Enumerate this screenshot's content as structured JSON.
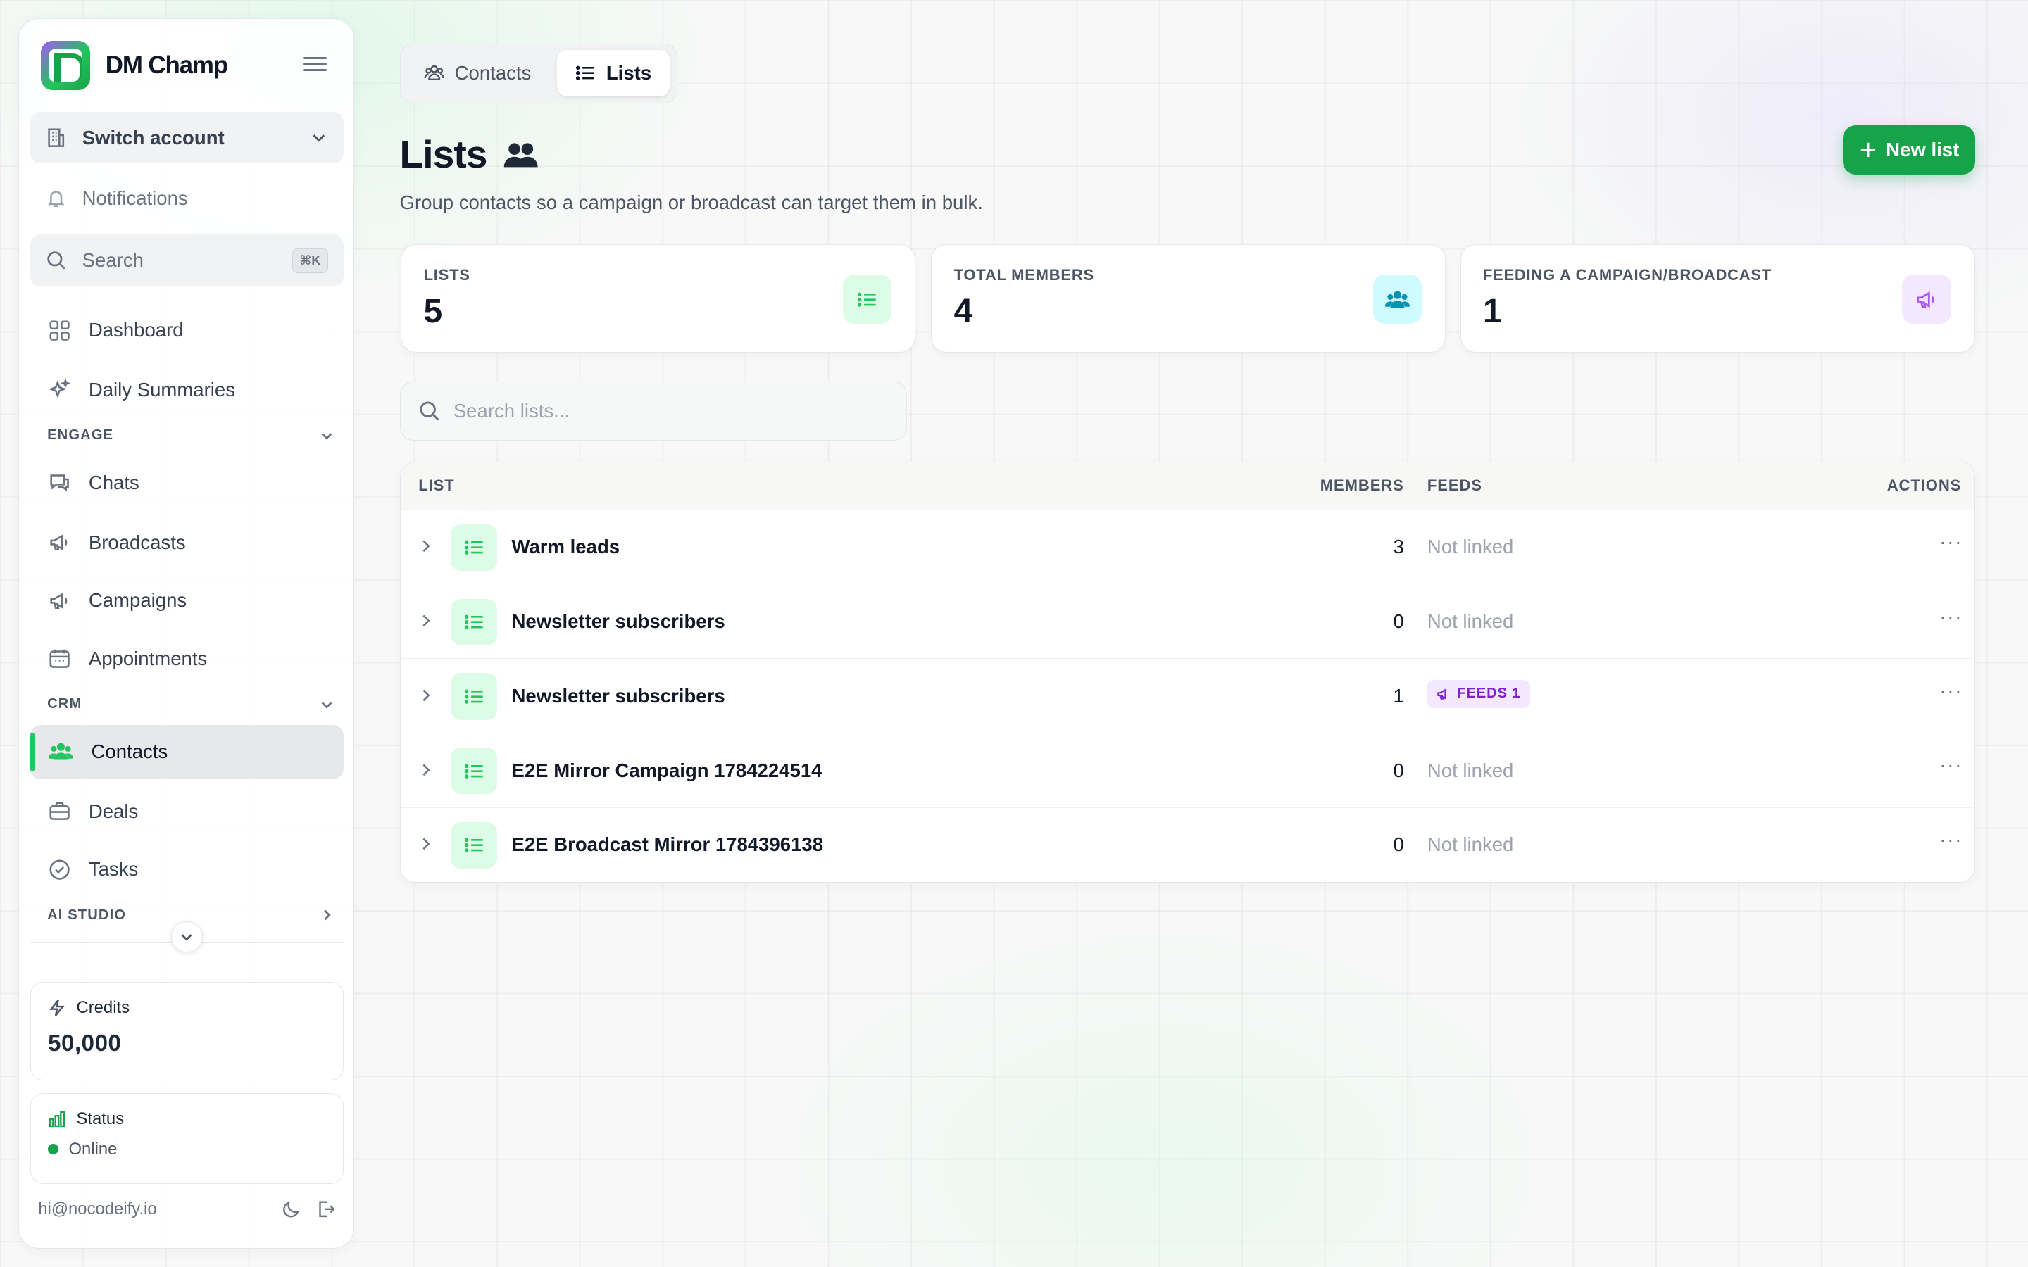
{
  "brand": {
    "name": "DM Champ"
  },
  "sidebar": {
    "switch_account": "Switch account",
    "notifications": "Notifications",
    "search": {
      "label": "Search",
      "shortcut": "⌘K"
    },
    "top_items": [
      {
        "label": "Dashboard",
        "icon": "grid-icon"
      },
      {
        "label": "Daily Summaries",
        "icon": "sparkles-icon"
      }
    ],
    "sections": [
      {
        "label": "ENGAGE",
        "items": [
          "Chats",
          "Broadcasts",
          "Campaigns",
          "Appointments"
        ]
      },
      {
        "label": "CRM",
        "items": [
          "Contacts",
          "Deals",
          "Tasks"
        ]
      },
      {
        "label": "AI STUDIO",
        "items": []
      }
    ],
    "active_item": "Contacts",
    "credits": {
      "label": "Credits",
      "value": "50,000"
    },
    "status": {
      "label": "Status",
      "value": "Online",
      "color": "#16a34a"
    },
    "footer_email": "hi@nocodeify.io"
  },
  "tabs": [
    {
      "label": "Contacts",
      "active": false
    },
    {
      "label": "Lists",
      "active": true
    }
  ],
  "page": {
    "title": "Lists",
    "subtitle": "Group contacts so a campaign or broadcast can target them in bulk.",
    "new_button": "New list"
  },
  "stats": [
    {
      "label": "LISTS",
      "value": "5",
      "icon": "list-icon",
      "color": "#22c55e"
    },
    {
      "label": "TOTAL MEMBERS",
      "value": "4",
      "icon": "users-icon",
      "color": "#06b6d4"
    },
    {
      "label": "FEEDING A CAMPAIGN/BROADCAST",
      "value": "1",
      "icon": "megaphone-icon",
      "color": "#a855f7"
    }
  ],
  "search_lists": {
    "placeholder": "Search lists..."
  },
  "table": {
    "headers": {
      "list": "LIST",
      "members": "MEMBERS",
      "feeds": "FEEDS",
      "actions": "ACTIONS"
    },
    "rows": [
      {
        "name": "Warm leads",
        "members": "3",
        "feeds": "Not linked"
      },
      {
        "name": "Newsletter subscribers",
        "members": "0",
        "feeds": "Not linked"
      },
      {
        "name": "Newsletter subscribers",
        "members": "1",
        "feeds": "FEEDS 1"
      },
      {
        "name": "E2E Mirror Campaign 1784224514",
        "members": "0",
        "feeds": "Not linked"
      },
      {
        "name": "E2E Broadcast Mirror 1784396138",
        "members": "0",
        "feeds": "Not linked"
      }
    ],
    "actions_label": "···"
  },
  "colors": {
    "accent": "#16a34a",
    "purple": "#7e22ce",
    "cyan": "#06b6d4"
  }
}
